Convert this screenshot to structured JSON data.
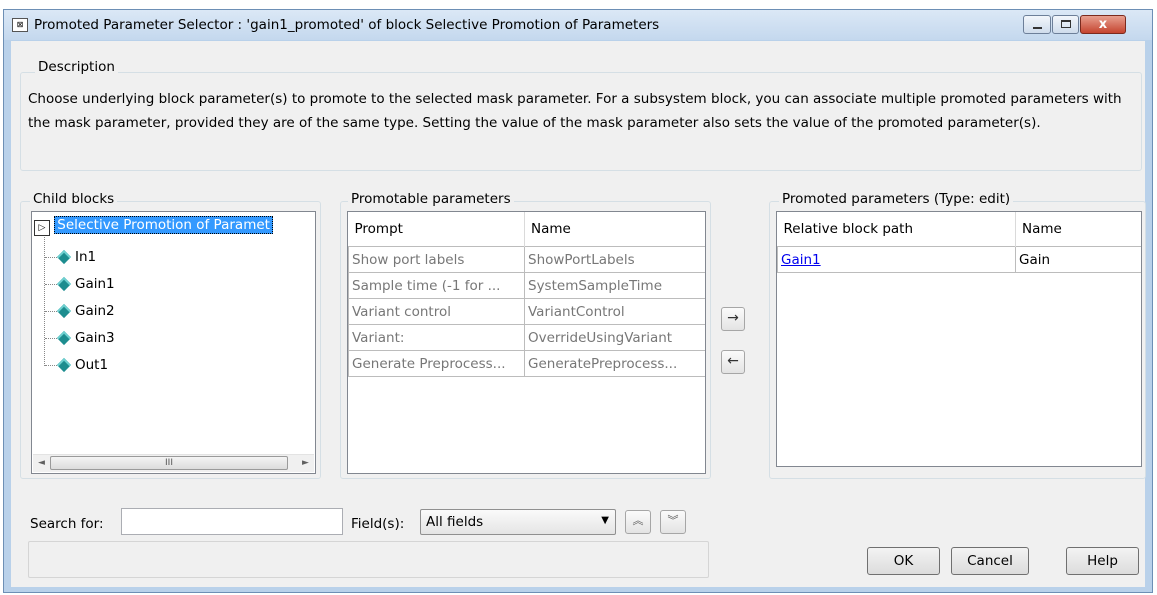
{
  "window": {
    "title": "Promoted Parameter Selector : 'gain1_promoted' of block Selective Promotion of Parameters",
    "app_icon": "block-diagram-icon",
    "close_glyph": "x"
  },
  "description": {
    "legend": "Description",
    "text": "Choose underlying block parameter(s) to promote to the selected mask parameter. For a subsystem block, you can associate multiple promoted parameters with the mask parameter, provided they are of the same type. Setting the value of the mask parameter also sets the value of the promoted parameter(s)."
  },
  "child_blocks": {
    "legend": "Child blocks",
    "root": "Selective Promotion of Paramet",
    "children": [
      "In1",
      "Gain1",
      "Gain2",
      "Gain3",
      "Out1"
    ],
    "scroll_left": "◄",
    "scroll_right": "►",
    "scroll_grip": "III"
  },
  "promotable": {
    "legend": "Promotable parameters",
    "columns": [
      "Prompt",
      "Name"
    ],
    "rows": [
      [
        "Show port labels",
        "ShowPortLabels"
      ],
      [
        "Sample time (-1 for ...",
        "SystemSampleTime"
      ],
      [
        "Variant control",
        "VariantControl"
      ],
      [
        "Variant:",
        "OverrideUsingVariant"
      ],
      [
        "Generate Preprocess...",
        "GeneratePreprocess..."
      ]
    ]
  },
  "transfer": {
    "add": "→",
    "remove": "←"
  },
  "promoted": {
    "legend": "Promoted parameters (Type: edit)",
    "columns": [
      "Relative block path",
      "Name"
    ],
    "rows": [
      [
        "Gain1",
        "Gain"
      ]
    ]
  },
  "search": {
    "label": "Search for:",
    "value": "",
    "fields_label": "Field(s):",
    "fields_value": "All fields",
    "up": "︽",
    "down": "︾"
  },
  "buttons": {
    "ok": "OK",
    "cancel": "Cancel",
    "help": "Help"
  }
}
